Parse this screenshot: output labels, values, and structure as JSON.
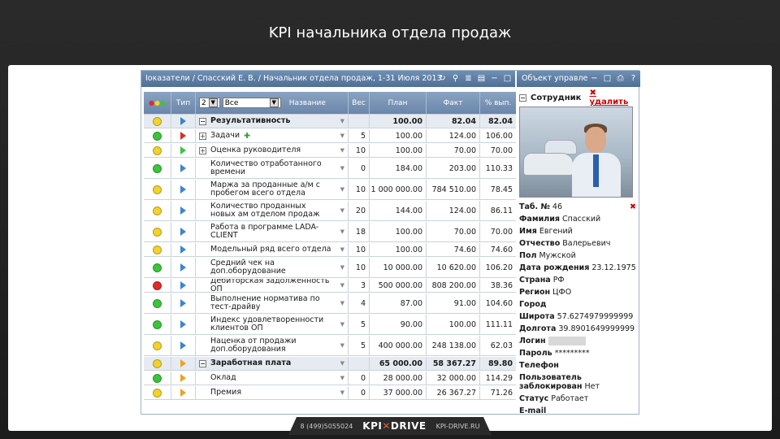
{
  "slide": {
    "title": "KPI начальника отдела продаж"
  },
  "window": {
    "title": "Іоказатели / Спасский Е. В. / Начальник отдела продаж, 1-31 Июля 2013",
    "side_title": "Объект управле"
  },
  "columns": {
    "type": "Тип",
    "level_select": "2",
    "filter_select": "Все",
    "name": "Название",
    "weight": "Вес",
    "plan": "План",
    "fact": "Факт",
    "percent": "% вып."
  },
  "rows": [
    {
      "status": "yellow",
      "type": "blue",
      "expand": "−",
      "name": "Результативность",
      "weight": "",
      "plan": "100.00",
      "fact": "82.04",
      "pct": "82.04",
      "section": true
    },
    {
      "status": "green",
      "type": "red",
      "expand": "+",
      "name": "Задачи",
      "weight": "5",
      "plan": "100.00",
      "fact": "124.00",
      "pct": "106.00",
      "plus": true
    },
    {
      "status": "yellow",
      "type": "green",
      "expand": "+",
      "name": "Оценка руководителя",
      "weight": "10",
      "plan": "100.00",
      "fact": "70.00",
      "pct": "70.00"
    },
    {
      "status": "green",
      "type": "blue",
      "name": "Количество отработанного времени",
      "weight": "0",
      "plan": "184.00",
      "fact": "203.00",
      "pct": "110.33"
    },
    {
      "status": "yellow",
      "type": "blue",
      "name": "Маржа за проданные а/м с пробегом всего отдела",
      "weight": "10",
      "plan": "1 000 000.00",
      "fact": "784 510.00",
      "pct": "78.45"
    },
    {
      "status": "yellow",
      "type": "blue",
      "name": "Количество проданных новых ам отделом продаж",
      "weight": "20",
      "plan": "144.00",
      "fact": "124.00",
      "pct": "86.11"
    },
    {
      "status": "yellow",
      "type": "blue",
      "name": "Работа в программе LADA-CLIENT",
      "weight": "18",
      "plan": "100.00",
      "fact": "70.00",
      "pct": "70.00"
    },
    {
      "status": "yellow",
      "type": "blue",
      "name": "Модельный ряд всего отдела",
      "weight": "10",
      "plan": "100.00",
      "fact": "74.60",
      "pct": "74.60"
    },
    {
      "status": "green",
      "type": "blue",
      "name": "Средний чек на доп.оборудование",
      "weight": "10",
      "plan": "10 000.00",
      "fact": "10 620.00",
      "pct": "106.20"
    },
    {
      "status": "red",
      "type": "blue",
      "name": "Дебиторская задолженность ОП",
      "weight": "3",
      "plan": "500 000.00",
      "fact": "808 200.00",
      "pct": "38.36"
    },
    {
      "status": "green",
      "type": "blue",
      "name": "Выполнение норматива по тест-драйву",
      "weight": "4",
      "plan": "87.00",
      "fact": "91.00",
      "pct": "104.60"
    },
    {
      "status": "green",
      "type": "blue",
      "name": "Индекс удовлетворенности клиентов ОП",
      "weight": "5",
      "plan": "90.00",
      "fact": "100.00",
      "pct": "111.11"
    },
    {
      "status": "yellow",
      "type": "blue",
      "name": "Наценка от продажи доп.оборудования",
      "weight": "5",
      "plan": "400 000.00",
      "fact": "248 138.00",
      "pct": "62.03"
    },
    {
      "status": "yellow",
      "type": "orange",
      "expand": "−",
      "name": "Заработная плата",
      "weight": "",
      "plan": "65 000.00",
      "fact": "58 367.27",
      "pct": "89.80",
      "section": true
    },
    {
      "status": "green",
      "type": "orange",
      "name": "Оклад",
      "weight": "0",
      "plan": "28 000.00",
      "fact": "32 000.00",
      "pct": "114.29",
      "indent": true
    },
    {
      "status": "yellow",
      "type": "orange",
      "name": "Премия",
      "weight": "0",
      "plan": "37 000.00",
      "fact": "26 367.27",
      "pct": "71.26",
      "indent": true
    }
  ],
  "employee": {
    "header": "Сотрудник",
    "delete": "удалить",
    "tab_label": "Таб. №",
    "tab_value": "46",
    "surname_label": "Фамилия",
    "surname": "Спасский",
    "name_label": "Имя",
    "name": "Евгений",
    "patronymic_label": "Отчество",
    "patronymic": "Валерьевич",
    "sex_label": "Пол",
    "sex": "Мужской",
    "birth_label": "Дата рождения",
    "birth": "23.12.1975",
    "country_label": "Страна",
    "country": "РФ",
    "region_label": "Регион",
    "region": "ЦФО",
    "city_label": "Город",
    "lat_label": "Широта",
    "lat": "57.6274979999999",
    "lon_label": "Долгота",
    "lon": "39.8901649999999",
    "login_label": "Логин",
    "password_label": "Пароль",
    "password": "*********",
    "phone_label": "Телефон",
    "blocked_label": "Пользователь заблокирован",
    "blocked": "Нет",
    "status_label": "Статус",
    "status": "Работает",
    "email_label": "E-mail"
  },
  "footer": {
    "phone": "8 (499)5055024",
    "brand_left": "KPI",
    "brand_right": "DRIVE",
    "site": "KPI-DRIVE.RU"
  },
  "colors": {
    "green": "#3cc43c",
    "yellow": "#f2d22c",
    "red": "#e02b2b",
    "blue": "#3a86d0",
    "orange": "#f0a21e"
  }
}
